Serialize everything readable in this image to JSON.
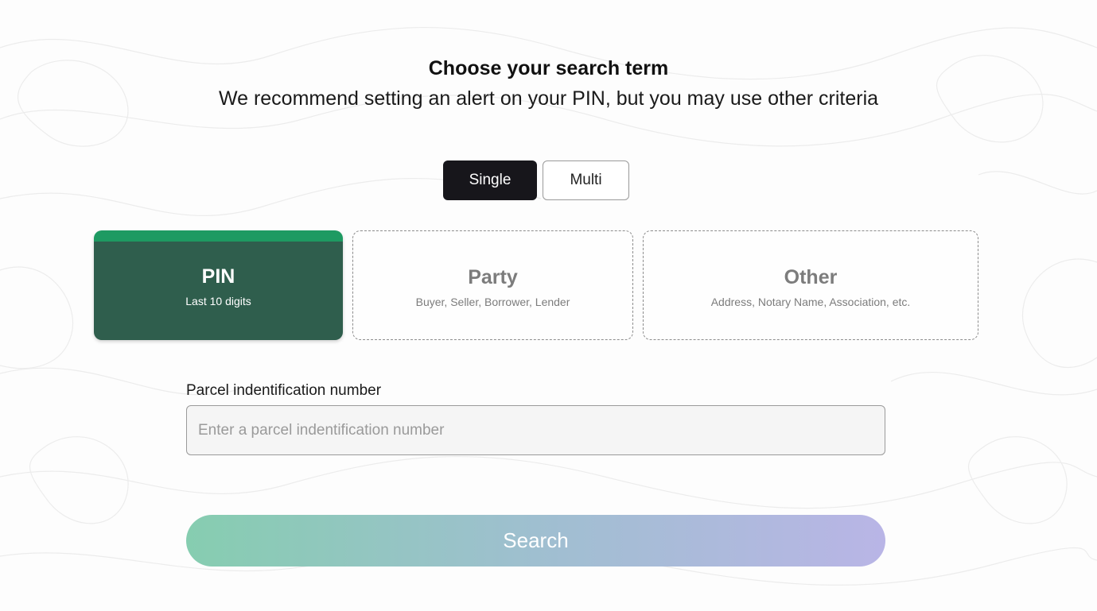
{
  "header": {
    "title": "Choose your search term",
    "subtitle": "We recommend setting an alert on your PIN, but you may use other criteria"
  },
  "mode_toggle": {
    "single_label": "Single",
    "multi_label": "Multi",
    "selected": "Single"
  },
  "search_types": [
    {
      "title": "PIN",
      "subtitle": "Last 10 digits",
      "selected": true
    },
    {
      "title": "Party",
      "subtitle": "Buyer, Seller, Borrower, Lender",
      "selected": false
    },
    {
      "title": "Other",
      "subtitle": "Address, Notary Name, Association, etc.",
      "selected": false
    }
  ],
  "pin_field": {
    "label": "Parcel indentification number",
    "placeholder": "Enter a parcel indentification number",
    "value": ""
  },
  "search_button": {
    "label": "Search"
  },
  "colors": {
    "selected_card_bg": "#2f5e4d",
    "selected_card_accent": "#1e9a62",
    "toggle_active_bg": "#17161b",
    "button_gradient_start": "#86cdb0",
    "button_gradient_end": "#b9b5e6"
  }
}
